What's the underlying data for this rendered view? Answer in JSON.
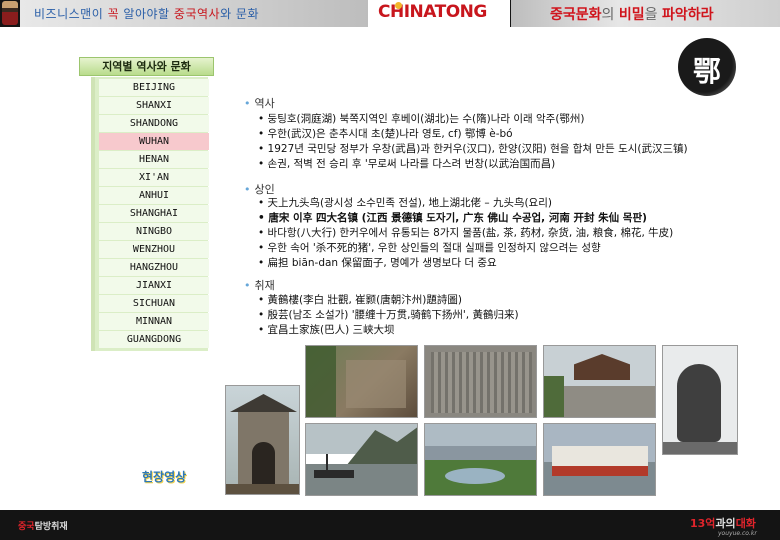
{
  "header": {
    "left_parts": [
      {
        "text": "비즈니스맨이 ",
        "hl": false
      },
      {
        "text": "꼭",
        "hl": true
      },
      {
        "text": " 알아야할 ",
        "hl": false
      },
      {
        "text": "중국역사",
        "hl": true
      },
      {
        "text": "와 문화",
        "hl": false
      }
    ],
    "logo": "CHINATONG",
    "right_parts": [
      {
        "text": "중국문화",
        "p": false
      },
      {
        "text": "의 ",
        "p": true
      },
      {
        "text": "비밀",
        "p": false
      },
      {
        "text": "을 ",
        "p": true
      },
      {
        "text": "파악하라",
        "p": false
      }
    ]
  },
  "sidebar": {
    "title": "지역별 역사와 문화",
    "items": [
      "BEIJING",
      "SHANXI",
      "SHANDONG",
      "WUHAN",
      "HENAN",
      "XI'AN",
      "ANHUI",
      "SHANGHAI",
      "NINGBO",
      "WENZHOU",
      "HANGZHOU",
      "JIANXI",
      "SICHUAN",
      "MINNAN",
      "GUANGDONG"
    ],
    "active": "WUHAN",
    "video_label": "현장영상"
  },
  "badge": {
    "char": "鄂"
  },
  "sections": [
    {
      "title": "역사",
      "lines": [
        "둥팅호(洞庭湖) 북쪽지역인 후베이(湖北)는 수(隋)나라 이래 악주(鄂州)",
        "우한(武汉)은 춘추시대 초(楚)나라 영토, cf) 鄂博 è-bó",
        "1927년 국민당 정부가 우창(武昌)과 한커우(汉口), 한양(汉阳) 현을 합쳐 만든 도시(武汉三镇)",
        "손권, 적벽 전  승리 후 '무로써 나라를 다스려 번창(以武治国而昌)"
      ]
    },
    {
      "title": "상인",
      "lines": [
        "天上九头鸟(광시성 소수민족 전설), 地上湖北佬 – 九头鸟(요리)",
        "唐宋 이후 四大名镇 (江西 景德镇 도자기, 广东 佛山 수공업, 河南 开封 朱仙 목판)",
        "바다항(八大行) 한커우에서 유통되는 8가지 물품(盐, 茶, 药材, 杂货, 油, 粮食, 棉花, 牛皮)",
        "우한 속어 '杀不死的猪', 우한 상인들의 절대 실패를 인정하지 않으려는 성향",
        "扁担 biān-dan 保留面子, 명예가 생명보다 더 중요"
      ]
    },
    {
      "title": "취재",
      "lines": [
        "黃鶴樓(李白 壯觀, 崔颢(唐朝汴州)題詩圖)",
        "殷芸(남조 소설가) '腰缠十万贯,骑鹤下扬州', 黃鶴归来)",
        "宜昌土家族(巴人) 三峡大坝"
      ]
    }
  ],
  "footer": {
    "left_parts": [
      {
        "text": "중국",
        "hl": true
      },
      {
        "text": "탐방취재",
        "hl": false
      }
    ],
    "right_parts": [
      {
        "text": "13억",
        "hl": true
      },
      {
        "text": "과의",
        "hl": false
      },
      {
        "text": "대화",
        "hl": true
      }
    ],
    "sub": "youyue.co.kr"
  },
  "photos": [
    {
      "name": "photo-yellow-crane-gate",
      "sky": "#cfd8da",
      "ground": "#6b5a44"
    },
    {
      "name": "photo-carved-cliff",
      "sky": "#7e8a66",
      "ground": "#5a4a3a"
    },
    {
      "name": "photo-stone-relief",
      "sky": "#8d8a82",
      "ground": "#6f6c64"
    },
    {
      "name": "photo-temple-plaza",
      "sky": "#c7cfd3",
      "ground": "#8c8a80"
    },
    {
      "name": "photo-statue",
      "sky": "#e6e8ea",
      "ground": "#4a4a4a"
    },
    {
      "name": "photo-river-boats",
      "sky": "#b9c4c8",
      "ground": "#5c6a5a"
    },
    {
      "name": "photo-dam-park",
      "sky": "#a9b7c0",
      "ground": "#4f7a3a"
    },
    {
      "name": "photo-ferry",
      "sky": "#a7b3bf",
      "ground": "#7c8a90"
    }
  ]
}
